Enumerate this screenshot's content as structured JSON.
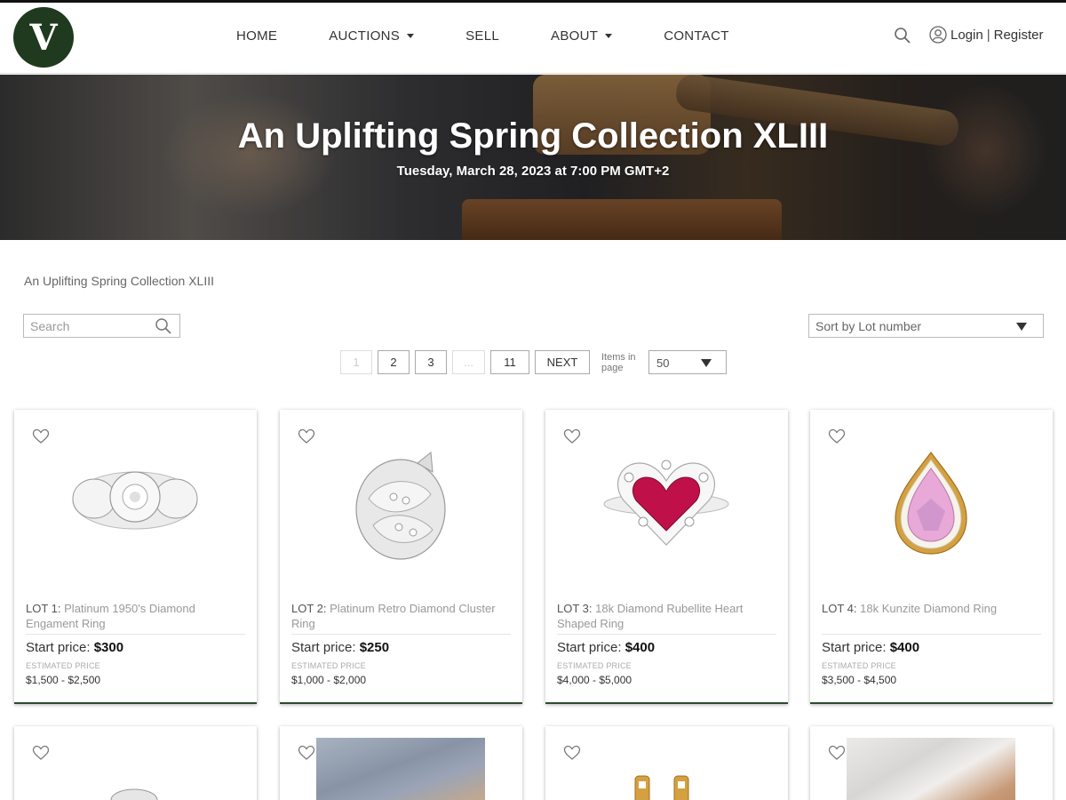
{
  "header": {
    "logo_letter": "V",
    "nav": [
      {
        "label": "HOME",
        "dropdown": false
      },
      {
        "label": "AUCTIONS",
        "dropdown": true
      },
      {
        "label": "SELL",
        "dropdown": false
      },
      {
        "label": "ABOUT",
        "dropdown": true
      },
      {
        "label": "CONTACT",
        "dropdown": false
      }
    ],
    "login_label": "Login",
    "separator": "|",
    "register_label": "Register"
  },
  "hero": {
    "title": "An Uplifting Spring Collection XLIII",
    "date": "Tuesday, March 28, 2023 at 7:00 PM GMT+2"
  },
  "breadcrumb": "An Uplifting Spring Collection XLIII",
  "search": {
    "placeholder": "Search"
  },
  "sort": {
    "selected": "Sort by Lot number"
  },
  "pagination": {
    "pages": [
      "1",
      "2",
      "3",
      "...",
      "11"
    ],
    "current": "1",
    "next_label": "NEXT",
    "items_label": "Items in page",
    "items_per_page": "50"
  },
  "lots": [
    {
      "lot_label": "LOT 1:",
      "title": "Platinum 1950's Diamond Engament Ring",
      "start_label": "Start price:",
      "start_price": "$300",
      "est_label": "ESTIMATED PRICE",
      "est_range": "$1,500 - $2,500",
      "image": "diamond-flower-ring"
    },
    {
      "lot_label": "LOT 2:",
      "title": "Platinum Retro Diamond Cluster Ring",
      "start_label": "Start price:",
      "start_price": "$250",
      "est_label": "ESTIMATED PRICE",
      "est_range": "$1,000 - $2,000",
      "image": "diamond-cluster-ring"
    },
    {
      "lot_label": "LOT 3:",
      "title": "18k Diamond Rubellite Heart Shaped Ring",
      "start_label": "Start price:",
      "start_price": "$400",
      "est_label": "ESTIMATED PRICE",
      "est_range": "$4,000 - $5,000",
      "image": "rubellite-heart-ring"
    },
    {
      "lot_label": "LOT 4:",
      "title": "18k Kunzite Diamond Ring",
      "start_label": "Start price:",
      "start_price": "$400",
      "est_label": "ESTIMATED PRICE",
      "est_range": "$3,500 - $4,500",
      "image": "kunzite-ring"
    }
  ],
  "colors": {
    "brand_green": "#1f3a1f",
    "card_accent": "#2e4a2e",
    "ruby": "#c0104a",
    "kunzite": "#e8a8d8",
    "gold": "#d4a040"
  }
}
